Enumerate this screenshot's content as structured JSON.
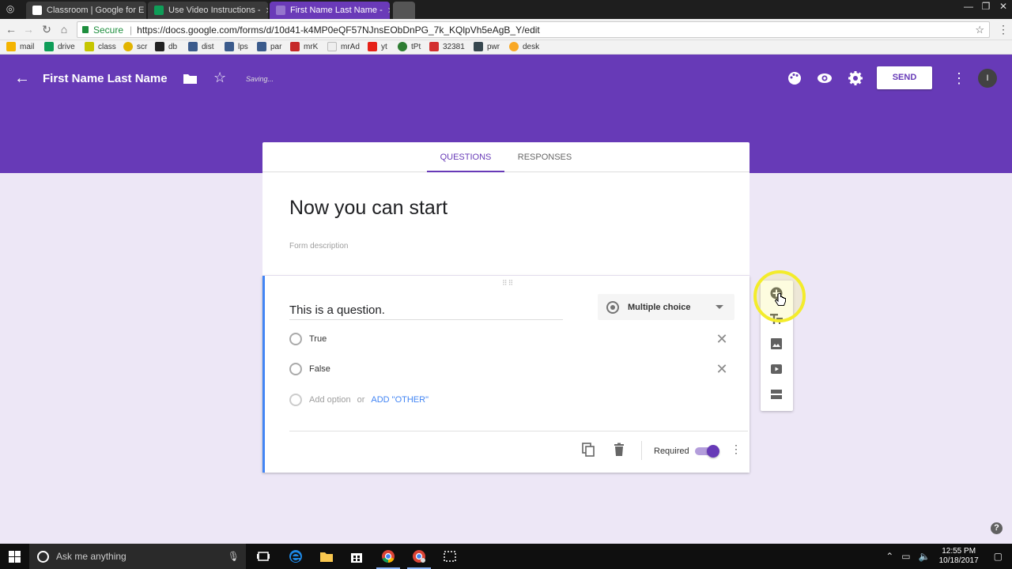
{
  "browser": {
    "tabs": [
      {
        "label": "Classroom | Google for E",
        "active": false
      },
      {
        "label": "Use Video Instructions -",
        "active": false
      },
      {
        "label": "First Name Last Name -",
        "active": true
      }
    ],
    "secure_label": "Secure",
    "url": "https://docs.google.com/forms/d/10d41-k4MP0eQF57NJnsEObDnPG_7k_KQlpVh5eAgB_Y/edit",
    "bookmarks": [
      "mail",
      "drive",
      "class",
      "scr",
      "db",
      "dist",
      "lps",
      "par",
      "mrK",
      "mrAd",
      "yt",
      "tPt",
      "32381",
      "pwr",
      "desk"
    ]
  },
  "header": {
    "title": "First Name Last Name",
    "status": "Saving...",
    "send_label": "SEND",
    "avatar_initial": "I",
    "color": "#673ab7"
  },
  "form_tabs": {
    "questions": "QUESTIONS",
    "responses": "RESPONSES"
  },
  "form": {
    "title": "Now you can start",
    "description_placeholder": "Form description"
  },
  "question": {
    "title": "This is a question.",
    "type": "Multiple choice",
    "options": [
      "True",
      "False"
    ],
    "add_option": "Add option",
    "or": "or",
    "add_other": "ADD \"OTHER\"",
    "required_label": "Required",
    "required": true
  },
  "side_toolbar": [
    "add-question-icon",
    "add-title-icon",
    "add-image-icon",
    "add-video-icon",
    "add-section-icon"
  ],
  "help_label": "?",
  "taskbar": {
    "search_placeholder": "Ask me anything",
    "time": "12:55 PM",
    "date": "10/18/2017"
  }
}
